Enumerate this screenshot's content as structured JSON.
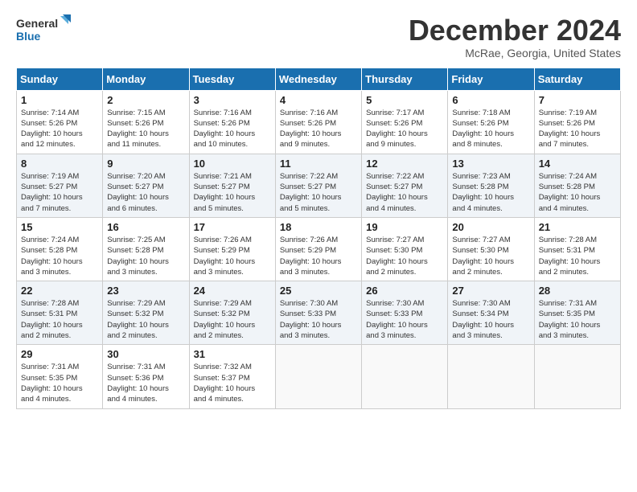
{
  "header": {
    "logo_line1": "General",
    "logo_line2": "Blue",
    "month_title": "December 2024",
    "location": "McRae, Georgia, United States"
  },
  "calendar": {
    "days_of_week": [
      "Sunday",
      "Monday",
      "Tuesday",
      "Wednesday",
      "Thursday",
      "Friday",
      "Saturday"
    ],
    "weeks": [
      [
        {
          "num": "",
          "info": ""
        },
        {
          "num": "2",
          "info": "Sunrise: 7:15 AM\nSunset: 5:26 PM\nDaylight: 10 hours\nand 11 minutes."
        },
        {
          "num": "3",
          "info": "Sunrise: 7:16 AM\nSunset: 5:26 PM\nDaylight: 10 hours\nand 10 minutes."
        },
        {
          "num": "4",
          "info": "Sunrise: 7:16 AM\nSunset: 5:26 PM\nDaylight: 10 hours\nand 9 minutes."
        },
        {
          "num": "5",
          "info": "Sunrise: 7:17 AM\nSunset: 5:26 PM\nDaylight: 10 hours\nand 9 minutes."
        },
        {
          "num": "6",
          "info": "Sunrise: 7:18 AM\nSunset: 5:26 PM\nDaylight: 10 hours\nand 8 minutes."
        },
        {
          "num": "7",
          "info": "Sunrise: 7:19 AM\nSunset: 5:26 PM\nDaylight: 10 hours\nand 7 minutes."
        }
      ],
      [
        {
          "num": "1",
          "info": "Sunrise: 7:14 AM\nSunset: 5:26 PM\nDaylight: 10 hours\nand 12 minutes."
        },
        {
          "num": "9",
          "info": "Sunrise: 7:20 AM\nSunset: 5:27 PM\nDaylight: 10 hours\nand 6 minutes."
        },
        {
          "num": "10",
          "info": "Sunrise: 7:21 AM\nSunset: 5:27 PM\nDaylight: 10 hours\nand 5 minutes."
        },
        {
          "num": "11",
          "info": "Sunrise: 7:22 AM\nSunset: 5:27 PM\nDaylight: 10 hours\nand 5 minutes."
        },
        {
          "num": "12",
          "info": "Sunrise: 7:22 AM\nSunset: 5:27 PM\nDaylight: 10 hours\nand 4 minutes."
        },
        {
          "num": "13",
          "info": "Sunrise: 7:23 AM\nSunset: 5:28 PM\nDaylight: 10 hours\nand 4 minutes."
        },
        {
          "num": "14",
          "info": "Sunrise: 7:24 AM\nSunset: 5:28 PM\nDaylight: 10 hours\nand 4 minutes."
        }
      ],
      [
        {
          "num": "8",
          "info": "Sunrise: 7:19 AM\nSunset: 5:27 PM\nDaylight: 10 hours\nand 7 minutes."
        },
        {
          "num": "16",
          "info": "Sunrise: 7:25 AM\nSunset: 5:28 PM\nDaylight: 10 hours\nand 3 minutes."
        },
        {
          "num": "17",
          "info": "Sunrise: 7:26 AM\nSunset: 5:29 PM\nDaylight: 10 hours\nand 3 minutes."
        },
        {
          "num": "18",
          "info": "Sunrise: 7:26 AM\nSunset: 5:29 PM\nDaylight: 10 hours\nand 3 minutes."
        },
        {
          "num": "19",
          "info": "Sunrise: 7:27 AM\nSunset: 5:30 PM\nDaylight: 10 hours\nand 2 minutes."
        },
        {
          "num": "20",
          "info": "Sunrise: 7:27 AM\nSunset: 5:30 PM\nDaylight: 10 hours\nand 2 minutes."
        },
        {
          "num": "21",
          "info": "Sunrise: 7:28 AM\nSunset: 5:31 PM\nDaylight: 10 hours\nand 2 minutes."
        }
      ],
      [
        {
          "num": "15",
          "info": "Sunrise: 7:24 AM\nSunset: 5:28 PM\nDaylight: 10 hours\nand 3 minutes."
        },
        {
          "num": "23",
          "info": "Sunrise: 7:29 AM\nSunset: 5:32 PM\nDaylight: 10 hours\nand 2 minutes."
        },
        {
          "num": "24",
          "info": "Sunrise: 7:29 AM\nSunset: 5:32 PM\nDaylight: 10 hours\nand 2 minutes."
        },
        {
          "num": "25",
          "info": "Sunrise: 7:30 AM\nSunset: 5:33 PM\nDaylight: 10 hours\nand 3 minutes."
        },
        {
          "num": "26",
          "info": "Sunrise: 7:30 AM\nSunset: 5:33 PM\nDaylight: 10 hours\nand 3 minutes."
        },
        {
          "num": "27",
          "info": "Sunrise: 7:30 AM\nSunset: 5:34 PM\nDaylight: 10 hours\nand 3 minutes."
        },
        {
          "num": "28",
          "info": "Sunrise: 7:31 AM\nSunset: 5:35 PM\nDaylight: 10 hours\nand 3 minutes."
        }
      ],
      [
        {
          "num": "22",
          "info": "Sunrise: 7:28 AM\nSunset: 5:31 PM\nDaylight: 10 hours\nand 2 minutes."
        },
        {
          "num": "30",
          "info": "Sunrise: 7:31 AM\nSunset: 5:36 PM\nDaylight: 10 hours\nand 4 minutes."
        },
        {
          "num": "31",
          "info": "Sunrise: 7:32 AM\nSunset: 5:37 PM\nDaylight: 10 hours\nand 4 minutes."
        },
        {
          "num": "",
          "info": ""
        },
        {
          "num": "",
          "info": ""
        },
        {
          "num": "",
          "info": ""
        },
        {
          "num": "",
          "info": ""
        }
      ],
      [
        {
          "num": "29",
          "info": "Sunrise: 7:31 AM\nSunset: 5:35 PM\nDaylight: 10 hours\nand 4 minutes."
        },
        {
          "num": "",
          "info": ""
        },
        {
          "num": "",
          "info": ""
        },
        {
          "num": "",
          "info": ""
        },
        {
          "num": "",
          "info": ""
        },
        {
          "num": "",
          "info": ""
        },
        {
          "num": "",
          "info": ""
        }
      ]
    ]
  }
}
